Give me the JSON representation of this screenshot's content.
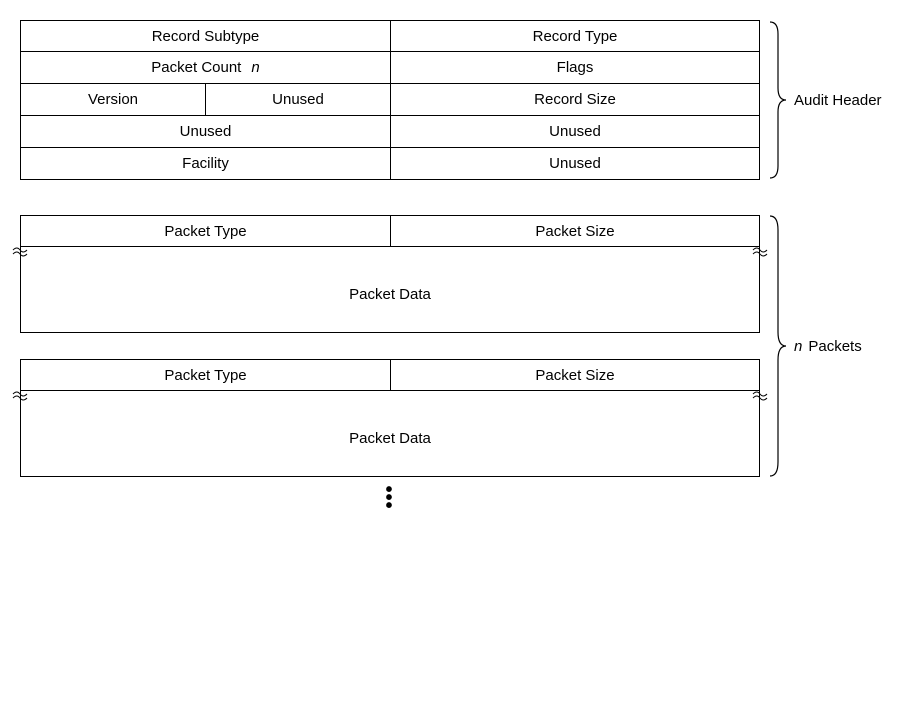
{
  "header": {
    "rows": [
      {
        "left": "Record Subtype",
        "right": "Record Type"
      },
      {
        "left_main": "Packet Count",
        "left_var": "n",
        "right": "Flags"
      },
      {
        "left_a": "Version",
        "left_b": "Unused",
        "right": "Record  Size"
      },
      {
        "left": "Unused",
        "right": "Unused"
      },
      {
        "left": "Facility",
        "right": "Unused"
      }
    ],
    "brace_label": "Audit Header"
  },
  "packets": {
    "brace_label": "Packets",
    "count_var": "n",
    "blocks": [
      {
        "type_label": "Packet  Type",
        "size_label": "Packet Size",
        "data_label": "Packet Data"
      },
      {
        "type_label": "Packet  Type",
        "size_label": "Packet Size",
        "data_label": "Packet Data"
      }
    ]
  }
}
